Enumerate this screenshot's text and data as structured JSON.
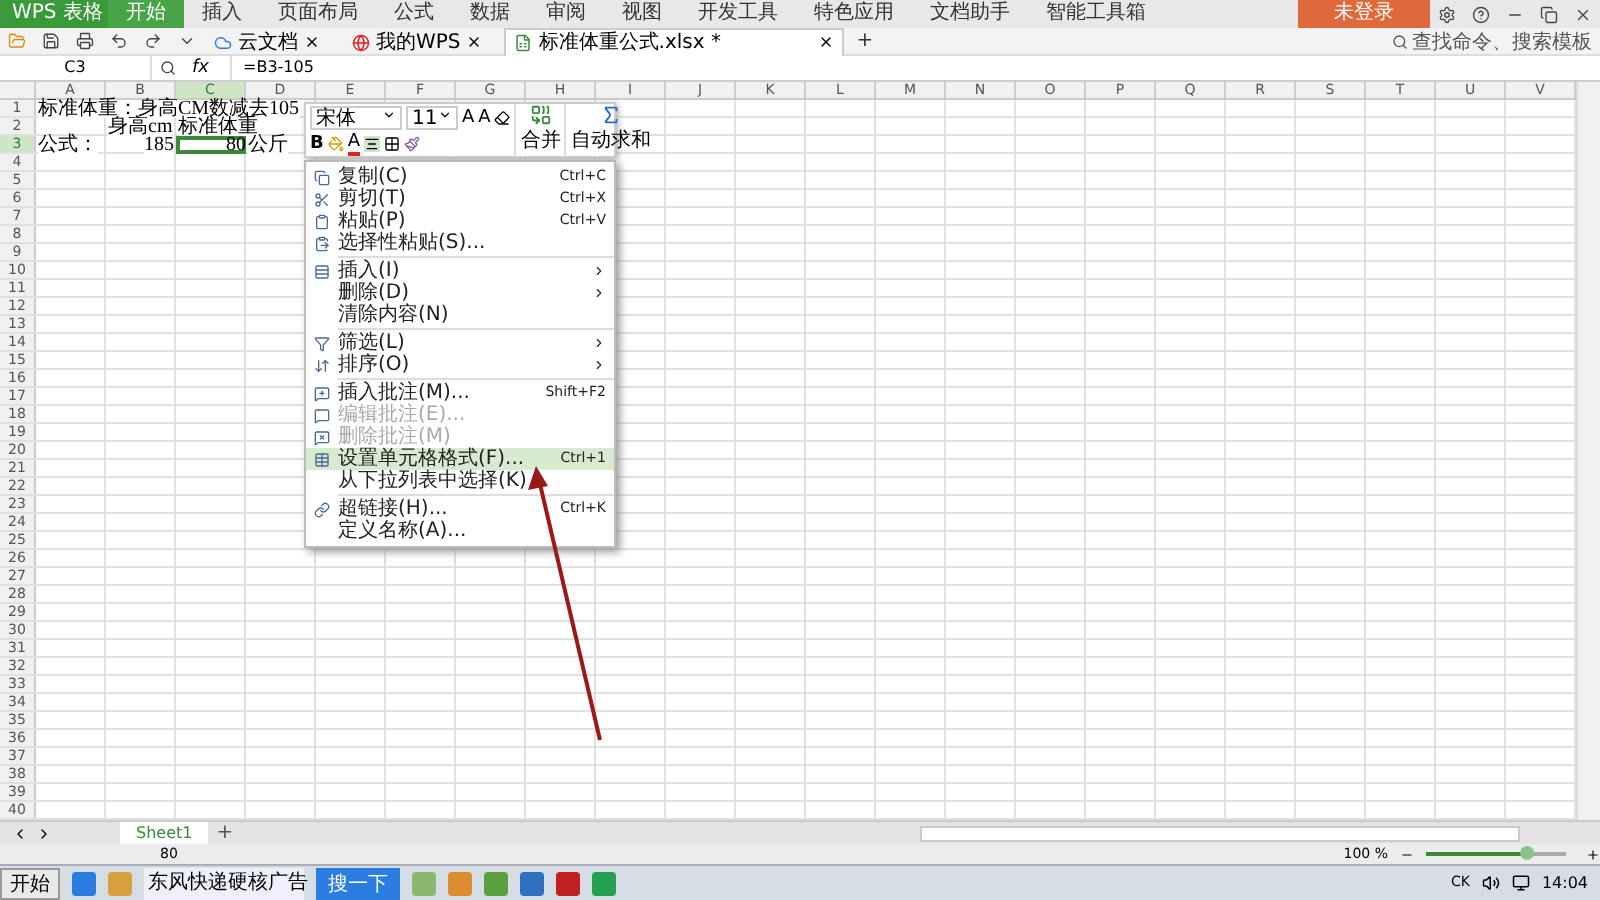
{
  "app": {
    "logo": "WPS 表格",
    "login": "未登录"
  },
  "ribbon_tabs": [
    {
      "label": "开始",
      "selected": true
    },
    {
      "label": "插入",
      "selected": false
    },
    {
      "label": "页面布局",
      "selected": false
    },
    {
      "label": "公式",
      "selected": false
    },
    {
      "label": "数据",
      "selected": false
    },
    {
      "label": "审阅",
      "selected": false
    },
    {
      "label": "视图",
      "selected": false
    },
    {
      "label": "开发工具",
      "selected": false
    },
    {
      "label": "特色应用",
      "selected": false
    },
    {
      "label": "文档助手",
      "selected": false
    },
    {
      "label": "智能工具箱",
      "selected": false
    }
  ],
  "doc_tabs": [
    {
      "label": "云文档",
      "selected": false
    },
    {
      "label": "我的WPS",
      "selected": false
    },
    {
      "label": "标准体重公式.xlsx *",
      "selected": true
    }
  ],
  "new_tab": "+",
  "search": {
    "placeholder": "查找命令、搜索模板"
  },
  "formula_bar": {
    "name_box": "C3",
    "fx": "fx",
    "formula": "=B3-105"
  },
  "columns": [
    {
      "label": "A",
      "selected": false
    },
    {
      "label": "B",
      "selected": false
    },
    {
      "label": "C",
      "selected": true
    },
    {
      "label": "D",
      "selected": false
    },
    {
      "label": "E",
      "selected": false
    },
    {
      "label": "F",
      "selected": false
    },
    {
      "label": "G",
      "selected": false
    },
    {
      "label": "H",
      "selected": false
    },
    {
      "label": "I",
      "selected": false
    },
    {
      "label": "J",
      "selected": false
    },
    {
      "label": "K",
      "selected": false
    },
    {
      "label": "L",
      "selected": false
    },
    {
      "label": "M",
      "selected": false
    },
    {
      "label": "N",
      "selected": false
    },
    {
      "label": "O",
      "selected": false
    },
    {
      "label": "P",
      "selected": false
    },
    {
      "label": "Q",
      "selected": false
    },
    {
      "label": "R",
      "selected": false
    },
    {
      "label": "S",
      "selected": false
    },
    {
      "label": "T",
      "selected": false
    },
    {
      "label": "U",
      "selected": false
    },
    {
      "label": "V",
      "selected": false
    }
  ],
  "rows": [
    {
      "label": "1",
      "selected": false,
      "cells": [
        {
          "text": "标准体重：身高CM数减去105",
          "kind": "text",
          "selected": false
        }
      ]
    },
    {
      "label": "2",
      "selected": false,
      "cells": [
        null,
        {
          "text": "身高cm",
          "kind": "text",
          "selected": false
        },
        {
          "text": "标准体重",
          "kind": "text",
          "selected": false
        }
      ]
    },
    {
      "label": "3",
      "selected": true,
      "cells": [
        {
          "text": "公式：",
          "kind": "text",
          "selected": false
        },
        {
          "text": "185",
          "kind": "number",
          "selected": false
        },
        {
          "text": "80",
          "kind": "number",
          "selected": true
        },
        {
          "text": "公斤",
          "kind": "text",
          "selected": false
        }
      ]
    },
    {
      "label": "4",
      "selected": false
    },
    {
      "label": "5",
      "selected": false
    },
    {
      "label": "6",
      "selected": false
    },
    {
      "label": "7",
      "selected": false
    },
    {
      "label": "8",
      "selected": false
    },
    {
      "label": "9",
      "selected": false
    },
    {
      "label": "10",
      "selected": false
    },
    {
      "label": "11",
      "selected": false
    },
    {
      "label": "12",
      "selected": false
    },
    {
      "label": "13",
      "selected": false
    },
    {
      "label": "14",
      "selected": false
    },
    {
      "label": "15",
      "selected": false
    },
    {
      "label": "16",
      "selected": false
    },
    {
      "label": "17",
      "selected": false
    },
    {
      "label": "18",
      "selected": false
    },
    {
      "label": "19",
      "selected": false
    },
    {
      "label": "20",
      "selected": false
    },
    {
      "label": "21",
      "selected": false
    },
    {
      "label": "22",
      "selected": false
    },
    {
      "label": "23",
      "selected": false
    },
    {
      "label": "24",
      "selected": false
    },
    {
      "label": "25",
      "selected": false
    },
    {
      "label": "26",
      "selected": false
    },
    {
      "label": "27",
      "selected": false
    },
    {
      "label": "28",
      "selected": false
    },
    {
      "label": "29",
      "selected": false
    },
    {
      "label": "30",
      "selected": false
    },
    {
      "label": "31",
      "selected": false
    },
    {
      "label": "32",
      "selected": false
    },
    {
      "label": "33",
      "selected": false
    },
    {
      "label": "34",
      "selected": false
    },
    {
      "label": "35",
      "selected": false
    },
    {
      "label": "36",
      "selected": false
    },
    {
      "label": "37",
      "selected": false
    },
    {
      "label": "38",
      "selected": false
    },
    {
      "label": "39",
      "selected": false
    },
    {
      "label": "40",
      "selected": false
    }
  ],
  "mini_toolbar": {
    "font": "宋体",
    "size": "11",
    "grow": "A",
    "shrink": "A",
    "bold": "B",
    "font_color": "A",
    "merge": "合并",
    "autosum": "自动求和"
  },
  "context_menu": [
    {
      "kind": "item",
      "label": "复制(C)",
      "shortcut": "Ctrl+C",
      "submenu": false,
      "disabled": false,
      "selected": false
    },
    {
      "kind": "item",
      "label": "剪切(T)",
      "shortcut": "Ctrl+X",
      "submenu": false,
      "disabled": false,
      "selected": false
    },
    {
      "kind": "item",
      "label": "粘贴(P)",
      "shortcut": "Ctrl+V",
      "submenu": false,
      "disabled": false,
      "selected": false
    },
    {
      "kind": "item",
      "label": "选择性粘贴(S)...",
      "submenu": false,
      "disabled": false,
      "selected": false
    },
    {
      "kind": "separator"
    },
    {
      "kind": "item",
      "label": "插入(I)",
      "submenu": true,
      "disabled": false,
      "selected": false
    },
    {
      "kind": "item",
      "label": "删除(D)",
      "submenu": true,
      "disabled": false,
      "selected": false
    },
    {
      "kind": "item",
      "label": "清除内容(N)",
      "submenu": false,
      "disabled": false,
      "selected": false
    },
    {
      "kind": "separator"
    },
    {
      "kind": "item",
      "label": "筛选(L)",
      "submenu": true,
      "disabled": false,
      "selected": false
    },
    {
      "kind": "item",
      "label": "排序(O)",
      "submenu": true,
      "disabled": false,
      "selected": false
    },
    {
      "kind": "separator"
    },
    {
      "kind": "item",
      "label": "插入批注(M)...",
      "shortcut": "Shift+F2",
      "submenu": false,
      "disabled": false,
      "selected": false
    },
    {
      "kind": "item",
      "label": "编辑批注(E)...",
      "submenu": false,
      "disabled": true,
      "selected": false
    },
    {
      "kind": "item",
      "label": "删除批注(M)",
      "submenu": false,
      "disabled": true,
      "selected": false
    },
    {
      "kind": "item",
      "label": "设置单元格格式(F)...",
      "shortcut": "Ctrl+1",
      "submenu": false,
      "disabled": false,
      "selected": true
    },
    {
      "kind": "item",
      "label": "从下拉列表中选择(K)",
      "submenu": false,
      "disabled": false,
      "selected": false
    },
    {
      "kind": "separator"
    },
    {
      "kind": "item",
      "label": "超链接(H)...",
      "shortcut": "Ctrl+K",
      "submenu": false,
      "disabled": false,
      "selected": false
    },
    {
      "kind": "item",
      "label": "定义名称(A)...",
      "submenu": false,
      "disabled": false,
      "selected": false
    }
  ],
  "sheet_tabs": [
    {
      "label": "Sheet1",
      "selected": true
    }
  ],
  "add_sheet": "+",
  "status_bar": {
    "value": "80",
    "zoom": "100 %",
    "zoom_slider": {
      "level": 0.72
    }
  },
  "taskbar": {
    "start": "开始",
    "tasks": [
      {
        "label": "东风快递硬核广告"
      }
    ],
    "search_button": "搜一下",
    "ime": "CK",
    "clock": "14:04"
  }
}
